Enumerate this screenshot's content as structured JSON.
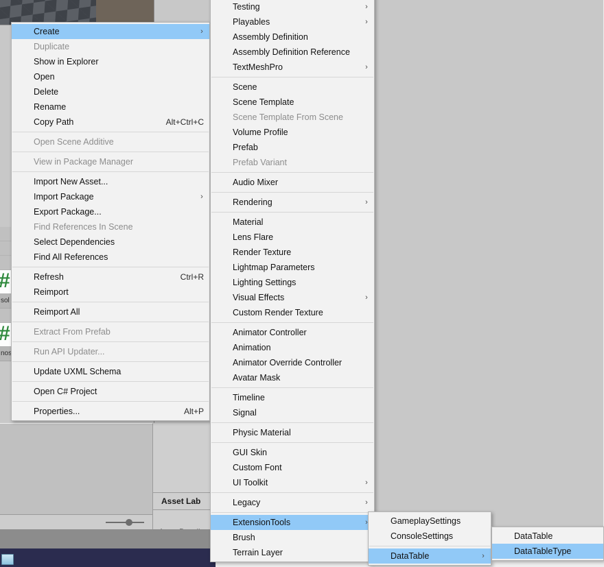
{
  "app": {
    "name": "Unity Editor",
    "accent_highlight": "#91c9f7",
    "menu_background": "#f2f2f2",
    "disabled_text": "#8d8d8d"
  },
  "background": {
    "project_panel": {
      "file_labels": [
        "sol",
        "nos"
      ],
      "file_icons": [
        "csharp-script-icon",
        "csharp-script-icon"
      ]
    },
    "inspector": {
      "asset_labels_header": "Asset Lab",
      "asset_bundle_label": "AssetBundl"
    }
  },
  "menus": {
    "asset_context": {
      "name": "asset-context-menu",
      "items": [
        {
          "label": "Create",
          "submenu": true,
          "selected": true
        },
        {
          "label": "Duplicate",
          "disabled": true
        },
        {
          "label": "Show in Explorer"
        },
        {
          "label": "Open"
        },
        {
          "label": "Delete"
        },
        {
          "label": "Rename"
        },
        {
          "label": "Copy Path",
          "accel": "Alt+Ctrl+C"
        },
        {
          "separator": true
        },
        {
          "label": "Open Scene Additive",
          "disabled": true
        },
        {
          "separator": true
        },
        {
          "label": "View in Package Manager",
          "disabled": true
        },
        {
          "separator": true
        },
        {
          "label": "Import New Asset..."
        },
        {
          "label": "Import Package",
          "submenu": true
        },
        {
          "label": "Export Package..."
        },
        {
          "label": "Find References In Scene",
          "disabled": true
        },
        {
          "label": "Select Dependencies"
        },
        {
          "label": "Find All References"
        },
        {
          "separator": true
        },
        {
          "label": "Refresh",
          "accel": "Ctrl+R"
        },
        {
          "label": "Reimport"
        },
        {
          "separator": true
        },
        {
          "label": "Reimport All"
        },
        {
          "separator": true
        },
        {
          "label": "Extract From Prefab",
          "disabled": true
        },
        {
          "separator": true
        },
        {
          "label": "Run API Updater...",
          "disabled": true
        },
        {
          "separator": true
        },
        {
          "label": "Update UXML Schema"
        },
        {
          "separator": true
        },
        {
          "label": "Open C# Project"
        },
        {
          "separator": true
        },
        {
          "label": "Properties...",
          "accel": "Alt+P"
        }
      ]
    },
    "create_submenu": {
      "name": "create-submenu",
      "items": [
        {
          "label": "Testing",
          "submenu": true
        },
        {
          "label": "Playables",
          "submenu": true
        },
        {
          "label": "Assembly Definition"
        },
        {
          "label": "Assembly Definition Reference"
        },
        {
          "label": "TextMeshPro",
          "submenu": true
        },
        {
          "separator": true
        },
        {
          "label": "Scene"
        },
        {
          "label": "Scene Template"
        },
        {
          "label": "Scene Template From Scene",
          "disabled": true
        },
        {
          "label": "Volume Profile"
        },
        {
          "label": "Prefab"
        },
        {
          "label": "Prefab Variant",
          "disabled": true
        },
        {
          "separator": true
        },
        {
          "label": "Audio Mixer"
        },
        {
          "separator": true
        },
        {
          "label": "Rendering",
          "submenu": true
        },
        {
          "separator": true
        },
        {
          "label": "Material"
        },
        {
          "label": "Lens Flare"
        },
        {
          "label": "Render Texture"
        },
        {
          "label": "Lightmap Parameters"
        },
        {
          "label": "Lighting Settings"
        },
        {
          "label": "Visual Effects",
          "submenu": true
        },
        {
          "label": "Custom Render Texture"
        },
        {
          "separator": true
        },
        {
          "label": "Animator Controller"
        },
        {
          "label": "Animation"
        },
        {
          "label": "Animator Override Controller"
        },
        {
          "label": "Avatar Mask"
        },
        {
          "separator": true
        },
        {
          "label": "Timeline"
        },
        {
          "label": "Signal"
        },
        {
          "separator": true
        },
        {
          "label": "Physic Material"
        },
        {
          "separator": true
        },
        {
          "label": "GUI Skin"
        },
        {
          "label": "Custom Font"
        },
        {
          "label": "UI Toolkit",
          "submenu": true
        },
        {
          "separator": true
        },
        {
          "label": "Legacy",
          "submenu": true
        },
        {
          "separator": true
        },
        {
          "label": "ExtensionTools",
          "submenu": true,
          "selected": true
        },
        {
          "label": "Brush"
        },
        {
          "label": "Terrain Layer"
        }
      ]
    },
    "extension_tools_submenu": {
      "name": "extension-tools-submenu",
      "items": [
        {
          "label": "GameplaySettings"
        },
        {
          "label": "ConsoleSettings"
        },
        {
          "separator": true
        },
        {
          "label": "DataTable",
          "submenu": true,
          "selected": true
        }
      ]
    },
    "datatable_submenu": {
      "name": "datatable-submenu",
      "items": [
        {
          "label": "DataTable"
        },
        {
          "label": "DataTableType",
          "selected": true
        }
      ]
    }
  }
}
